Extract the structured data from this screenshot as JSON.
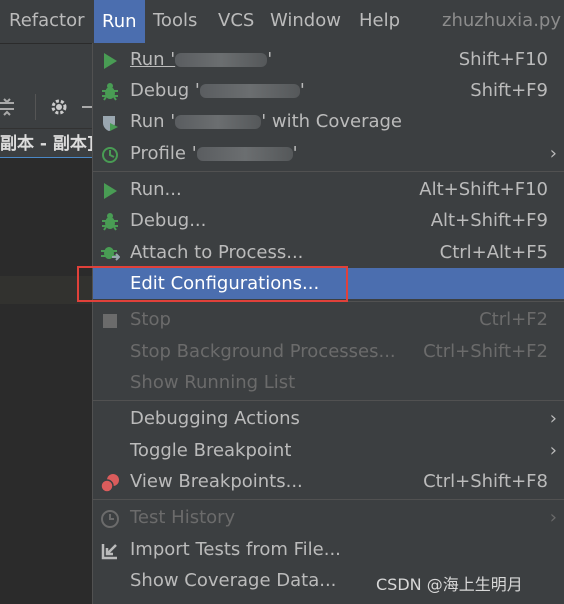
{
  "menubar": {
    "items": [
      "Refactor",
      "Run",
      "Tools",
      "VCS",
      "Window",
      "Help"
    ],
    "active": "Run",
    "project_title": "zhuzhuxia.py -"
  },
  "editor": {
    "tab_text": "副本 - 副本]"
  },
  "run_menu": {
    "items": [
      {
        "label": "Run '",
        "label_suffix": "'",
        "shortcut": "Shift+F10",
        "icon": "run-triangle-icon"
      },
      {
        "label": "Debug '",
        "label_suffix": "'",
        "shortcut": "Shift+F9",
        "icon": "debug-bug-icon"
      },
      {
        "label": "Run '",
        "label_suffix": "' with Coverage",
        "shortcut": "",
        "icon": "coverage-shield-icon"
      },
      {
        "label": "Profile '",
        "label_suffix": "'",
        "shortcut": "",
        "icon": "profile-icon",
        "submenu": true
      },
      {
        "label": "Run...",
        "shortcut": "Alt+Shift+F10",
        "icon": "run-triangle-icon"
      },
      {
        "label": "Debug...",
        "shortcut": "Alt+Shift+F9",
        "icon": "debug-bug-icon"
      },
      {
        "label": "Attach to Process...",
        "shortcut": "Ctrl+Alt+F5",
        "icon": "attach-bug-icon"
      },
      {
        "label": "Edit Configurations...",
        "shortcut": "",
        "icon": "",
        "selected": true
      },
      {
        "label": "Stop",
        "shortcut": "Ctrl+F2",
        "icon": "stop-square-icon",
        "disabled": true
      },
      {
        "label": "Stop Background Processes...",
        "shortcut": "Ctrl+Shift+F2",
        "disabled": true
      },
      {
        "label": "Show Running List",
        "shortcut": "",
        "disabled": true
      },
      {
        "label": "Debugging Actions",
        "shortcut": "",
        "submenu": true
      },
      {
        "label": "Toggle Breakpoint",
        "shortcut": "",
        "submenu": true
      },
      {
        "label": "View Breakpoints...",
        "shortcut": "Ctrl+Shift+F8",
        "icon": "breakpoints-icon"
      },
      {
        "label": "Test History",
        "shortcut": "",
        "icon": "clock-icon",
        "disabled": true,
        "submenu": true
      },
      {
        "label": "Import Tests from File...",
        "shortcut": "",
        "icon": "import-tests-icon"
      },
      {
        "label": "Show Coverage Data...",
        "shortcut": ""
      }
    ]
  },
  "watermark": "CSDN @海上生明月",
  "colors": {
    "background": "#3c3f41",
    "selection": "#4b6eaf",
    "run_green": "#499c54",
    "highlight_box": "#e0413a",
    "breakpoint_red": "#db5c5c"
  }
}
